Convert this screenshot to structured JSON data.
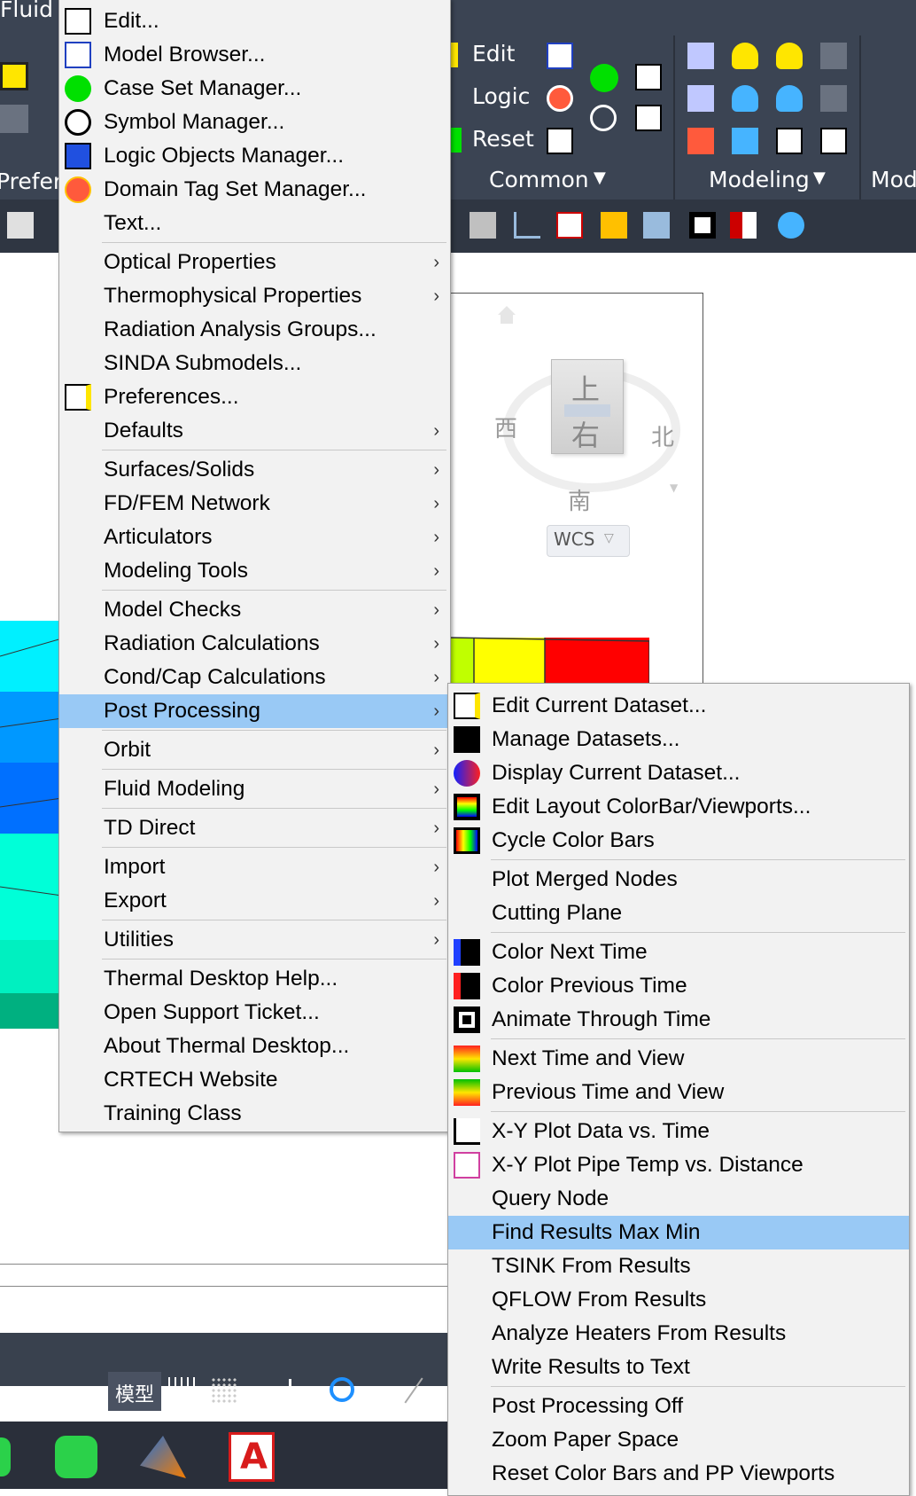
{
  "ribbon": {
    "left_label": "Fluid",
    "prefs_label": "Prefere",
    "common_items": [
      "Edit",
      "Logic",
      "Reset"
    ],
    "panels": [
      "Common",
      "Modeling",
      "Mod"
    ]
  },
  "viewcube": {
    "top": "上",
    "front": "右",
    "north": "北",
    "west": "西",
    "south": "南",
    "wcs": "WCS"
  },
  "statusbar": {
    "model_tab": "模型"
  },
  "main_menu": {
    "groups": [
      [
        {
          "label": "Edit...",
          "icon": "edit-icon"
        },
        {
          "label": "Model Browser...",
          "icon": "list-icon"
        },
        {
          "label": "Case Set Manager...",
          "icon": "green-circle-icon"
        },
        {
          "label": "Symbol Manager...",
          "icon": "theta-icon"
        },
        {
          "label": "Logic Objects Manager...",
          "icon": "logic-icon"
        },
        {
          "label": "Domain Tag Set Manager...",
          "icon": "tag-icon"
        },
        {
          "label": "Text...",
          "icon": ""
        }
      ],
      [
        {
          "label": "Optical Properties",
          "submenu": true
        },
        {
          "label": "Thermophysical Properties",
          "submenu": true
        },
        {
          "label": "Radiation Analysis Groups..."
        },
        {
          "label": "SINDA Submodels..."
        },
        {
          "label": "Preferences...",
          "icon": "prefs-icon"
        },
        {
          "label": "Defaults",
          "submenu": true
        }
      ],
      [
        {
          "label": "Surfaces/Solids",
          "submenu": true
        },
        {
          "label": "FD/FEM Network",
          "submenu": true
        },
        {
          "label": "Articulators",
          "submenu": true
        },
        {
          "label": "Modeling Tools",
          "submenu": true
        }
      ],
      [
        {
          "label": "Model Checks",
          "submenu": true
        },
        {
          "label": "Radiation Calculations",
          "submenu": true
        },
        {
          "label": "Cond/Cap Calculations",
          "submenu": true
        },
        {
          "label": "Post Processing",
          "submenu": true,
          "highlighted": true
        }
      ],
      [
        {
          "label": "Orbit",
          "submenu": true
        }
      ],
      [
        {
          "label": "Fluid Modeling",
          "submenu": true
        }
      ],
      [
        {
          "label": "TD Direct",
          "submenu": true
        }
      ],
      [
        {
          "label": "Import",
          "submenu": true
        },
        {
          "label": "Export",
          "submenu": true
        }
      ],
      [
        {
          "label": "Utilities",
          "submenu": true
        }
      ],
      [
        {
          "label": "Thermal Desktop Help..."
        },
        {
          "label": "Open Support Ticket..."
        },
        {
          "label": "About Thermal Desktop..."
        },
        {
          "label": "CRTECH Website"
        },
        {
          "label": "Training Class"
        }
      ]
    ]
  },
  "sub_menu": {
    "groups": [
      [
        {
          "label": "Edit Current Dataset...",
          "icon": "dataset-edit-icon"
        },
        {
          "label": "Manage Datasets...",
          "icon": "pp-icon"
        },
        {
          "label": "Display Current Dataset...",
          "icon": "display-dataset-icon"
        },
        {
          "label": "Edit Layout ColorBar/Viewports...",
          "icon": "colorbar-layout-icon"
        },
        {
          "label": "Cycle Color Bars",
          "icon": "cycle-colorbars-icon"
        }
      ],
      [
        {
          "label": "Plot Merged Nodes"
        },
        {
          "label": "Cutting Plane"
        }
      ],
      [
        {
          "label": "Color Next Time",
          "icon": "next-time-icon"
        },
        {
          "label": "Color Previous Time",
          "icon": "previous-time-icon"
        },
        {
          "label": "Animate Through Time",
          "icon": "animate-icon"
        }
      ],
      [
        {
          "label": "Next Time and View",
          "icon": "next-time-view-icon"
        },
        {
          "label": "Previous Time and View",
          "icon": "previous-time-view-icon"
        }
      ],
      [
        {
          "label": "X-Y Plot Data vs. Time",
          "icon": "xy-plot-icon"
        },
        {
          "label": "X-Y Plot Pipe Temp vs. Distance",
          "icon": "pipe-plot-icon"
        },
        {
          "label": "Query Node"
        },
        {
          "label": "Find Results Max Min",
          "highlighted": true
        },
        {
          "label": "TSINK From Results"
        },
        {
          "label": "QFLOW From Results"
        },
        {
          "label": "Analyze Heaters From Results"
        },
        {
          "label": "Write Results to Text"
        }
      ],
      [
        {
          "label": "Post Processing Off"
        },
        {
          "label": "Zoom Paper Space"
        },
        {
          "label": "Reset Color Bars and PP Viewports"
        }
      ]
    ]
  }
}
